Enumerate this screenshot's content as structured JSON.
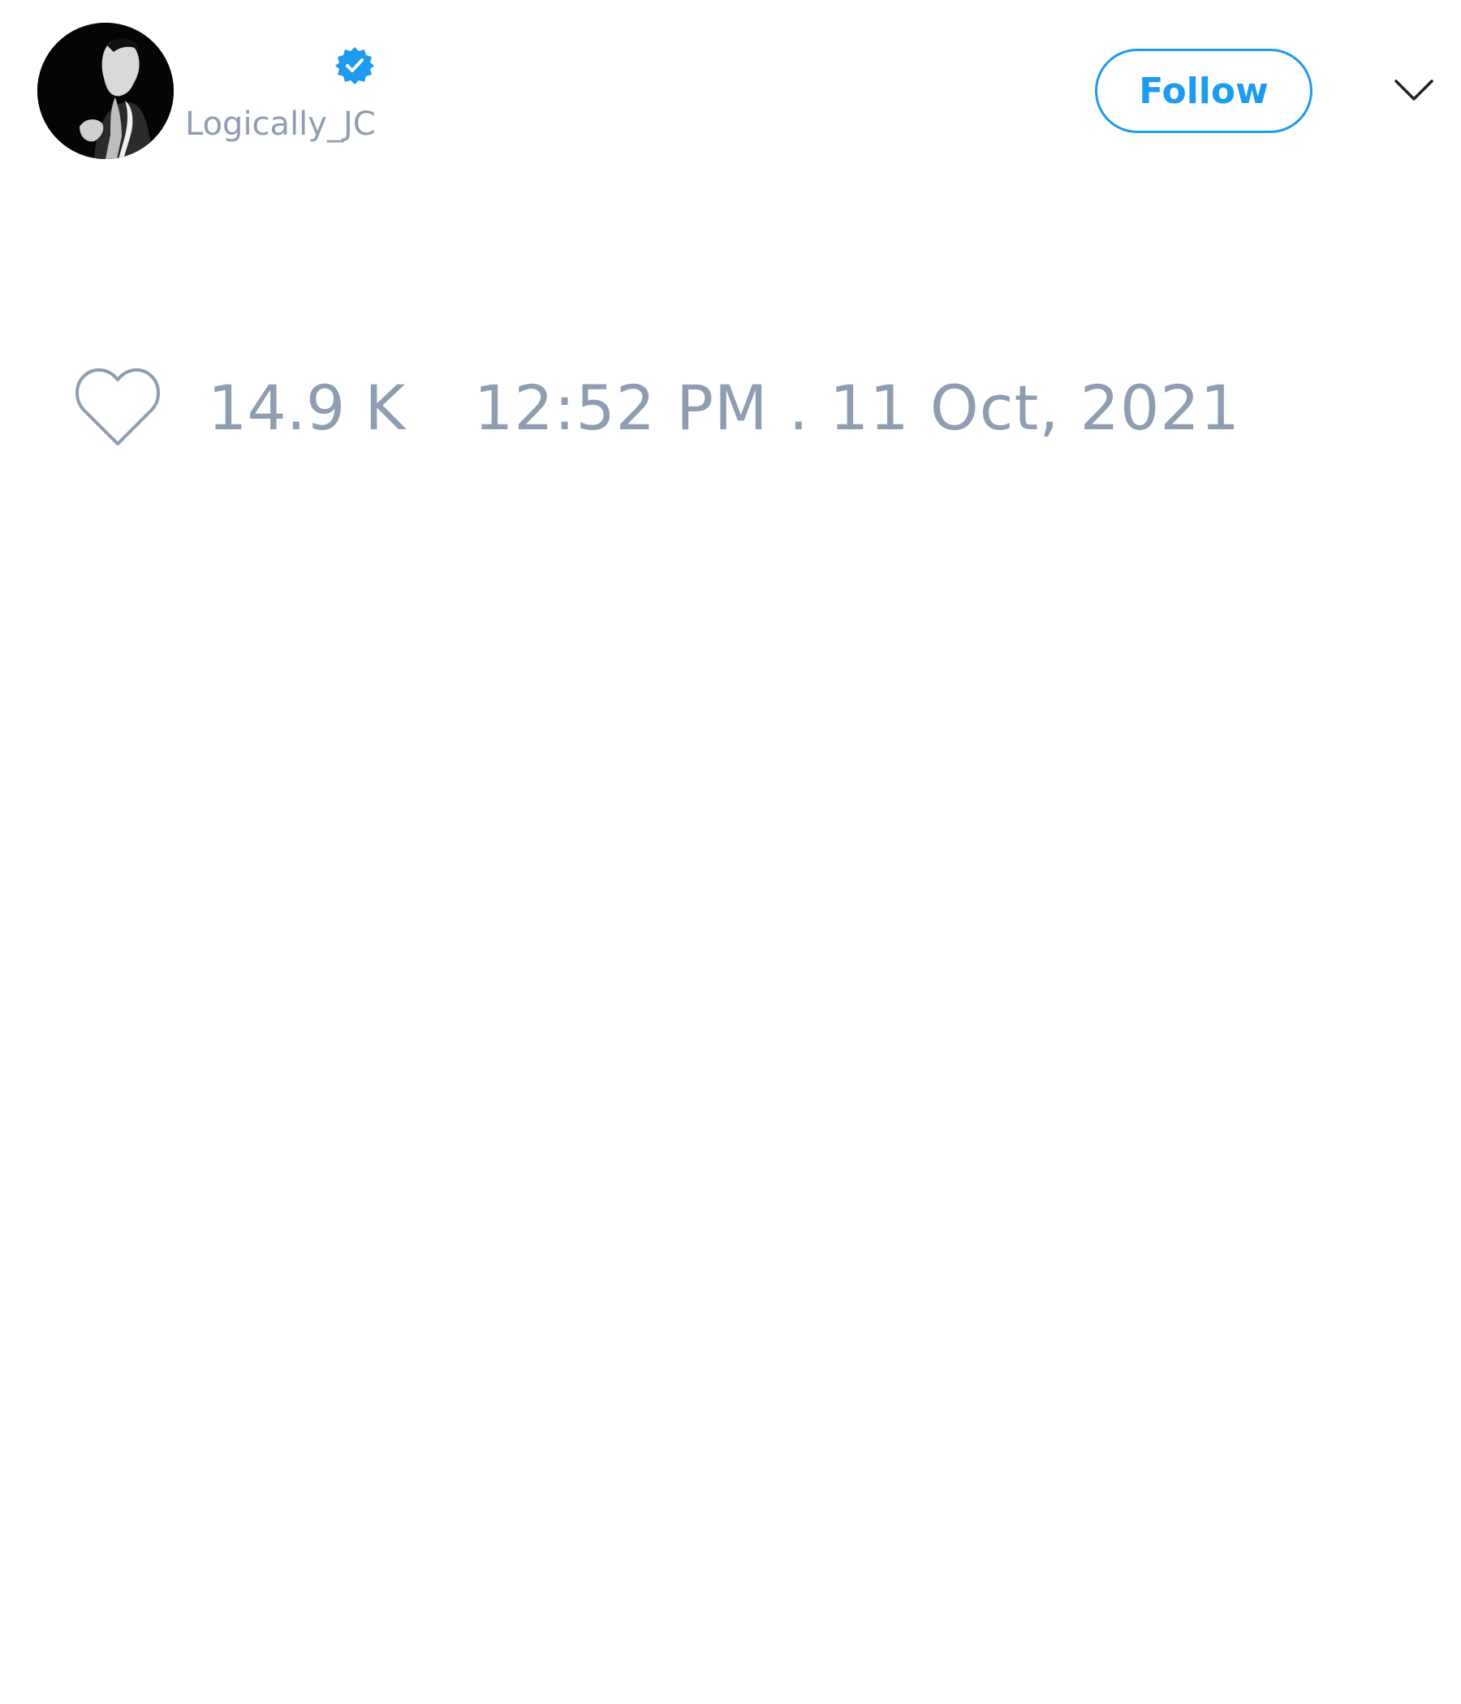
{
  "tweet": {
    "author": {
      "display_name": "",
      "handle": "Logically_JC",
      "verified": true,
      "avatar_icon": "avatar-photo"
    },
    "follow_label": "Follow",
    "more_icon": "chevron-down-icon",
    "like_icon": "heart-outline-icon",
    "like_count": "14.9 K",
    "timestamp": "12:52 PM . 11 Oct, 2021"
  },
  "colors": {
    "accent": "#1d9bf0",
    "muted_text": "#8f9db1",
    "background": "#ffffff"
  }
}
